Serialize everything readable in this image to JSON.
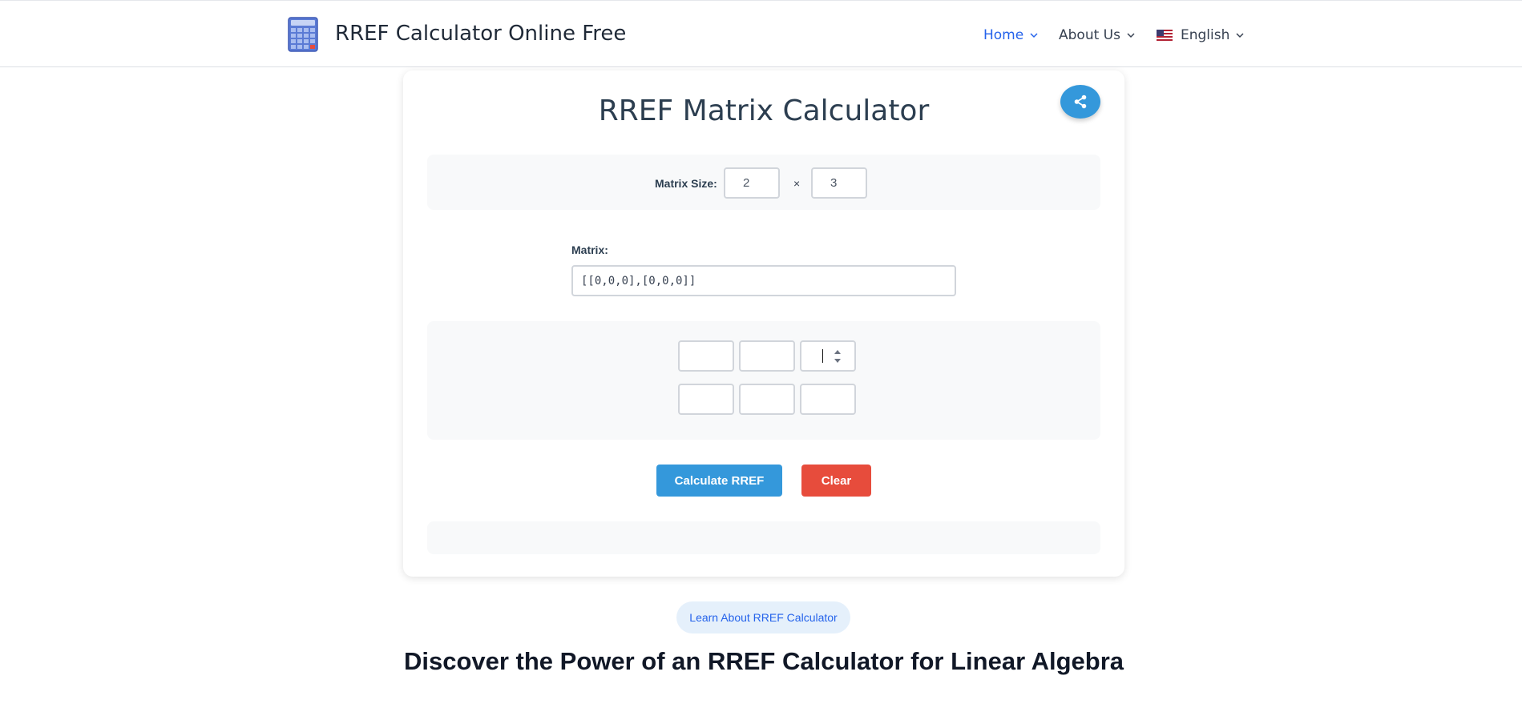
{
  "header": {
    "site_title": "RREF Calculator Online Free",
    "nav": [
      {
        "label": "Home",
        "active": true
      },
      {
        "label": "About Us",
        "active": false
      },
      {
        "label": "English",
        "active": false
      }
    ]
  },
  "calculator": {
    "title": "RREF Matrix Calculator",
    "size_label": "Matrix Size:",
    "rows": "2",
    "cols": "3",
    "times_symbol": "×",
    "matrix_label": "Matrix:",
    "matrix_value": "[[0,0,0],[0,0,0]]",
    "calculate_label": "Calculate RREF",
    "clear_label": "Clear"
  },
  "content": {
    "learn_pill": "Learn About RREF Calculator",
    "heading": "Discover the Power of an RREF Calculator for Linear Algebra"
  },
  "colors": {
    "primary": "#3498db",
    "danger": "#e74c3c",
    "nav_active": "#2563eb"
  }
}
